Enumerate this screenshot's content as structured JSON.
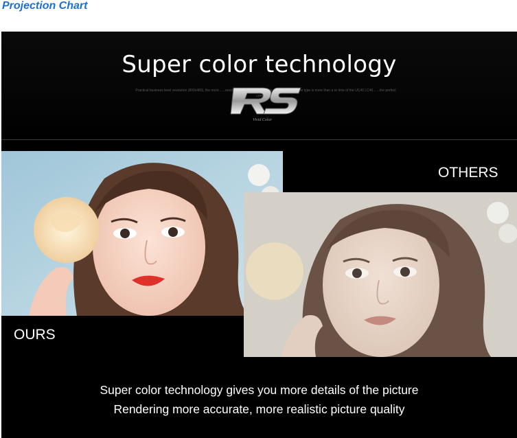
{
  "page": {
    "heading": "Projection Chart"
  },
  "banner": {
    "headline": "Super color technology",
    "fine_print": "Practical business level resolution (800x480), the most... ...resolution.The same resolution volume of the same type is more than a re time of the UC40 LC40... ...the perfect competitivity",
    "logo_text": "RS",
    "logo_subtext": "Vivid Color",
    "label_ours": "OURS",
    "label_others": "OTHERS",
    "caption_line1": "Super color technology gives you more details of the picture",
    "caption_line2": "Rendering more accurate, more realistic picture quality"
  },
  "colors": {
    "heading": "#1f6fd0",
    "background": "#000000",
    "text": "#ffffff"
  }
}
